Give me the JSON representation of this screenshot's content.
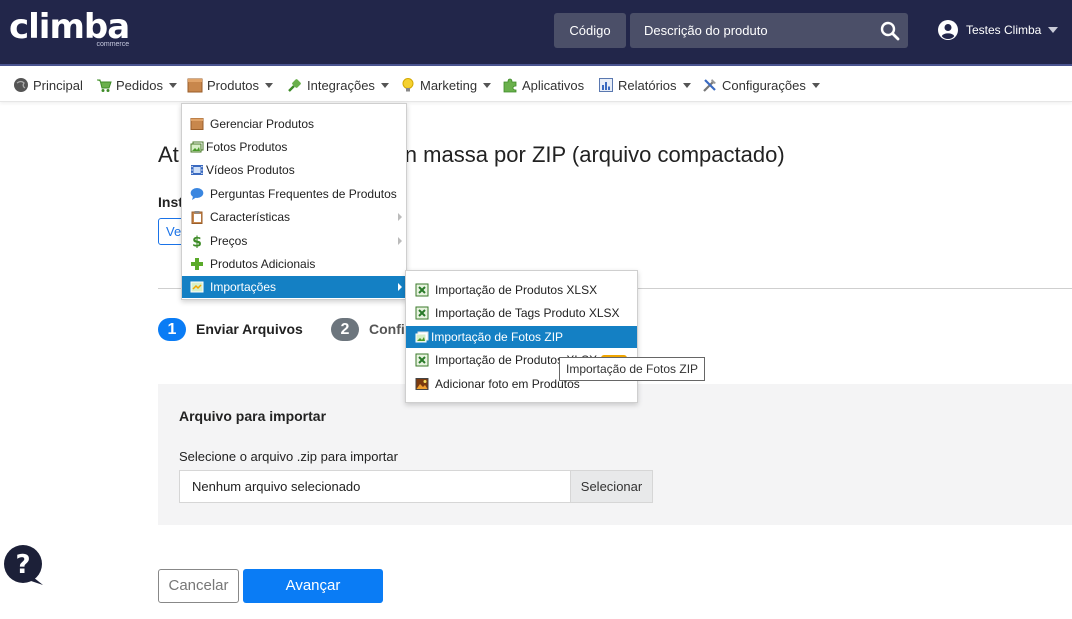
{
  "header": {
    "logo": "climba",
    "logo_sub": "commerce",
    "code_button": "Código",
    "search_placeholder": "Descrição do produto",
    "user_name": "Testes Climba"
  },
  "nav": {
    "items": [
      {
        "label": "Principal",
        "icon": "globe-icon"
      },
      {
        "label": "Pedidos",
        "icon": "cart-icon"
      },
      {
        "label": "Produtos",
        "icon": "box-icon"
      },
      {
        "label": "Integrações",
        "icon": "plug-icon"
      },
      {
        "label": "Marketing",
        "icon": "lightbulb-icon"
      },
      {
        "label": "Aplicativos",
        "icon": "puzzle-icon"
      },
      {
        "label": "Relatórios",
        "icon": "report-icon"
      },
      {
        "label": "Configurações",
        "icon": "tools-icon"
      }
    ]
  },
  "produtos_menu": [
    {
      "label": "Gerenciar Produtos"
    },
    {
      "label": "Fotos Produtos"
    },
    {
      "label": "Vídeos Produtos"
    },
    {
      "label": "Perguntas Frequentes de Produtos"
    },
    {
      "label": "Características"
    },
    {
      "label": "Preços"
    },
    {
      "label": "Produtos Adicionais"
    },
    {
      "label": "Importações"
    }
  ],
  "importacoes_menu": [
    {
      "label": "Importação de Produtos XLSX"
    },
    {
      "label": "Importação de Tags Produto XLSX"
    },
    {
      "label": "Importação de Fotos ZIP"
    },
    {
      "label": "Importação de Produtos XLSX"
    },
    {
      "label": "Adicionar foto em Produtos"
    }
  ],
  "tooltip": "Importação de Fotos ZIP",
  "page": {
    "title_left": "At",
    "title_right": "n massa por ZIP (arquivo compactado)",
    "instructions_label": "Inst",
    "view_button": "Ve",
    "steps": [
      {
        "number": "1",
        "label": "Enviar Arquivos",
        "color": "#0a7cf5"
      },
      {
        "number": "2",
        "label": "Confi",
        "color": "#6c757d"
      }
    ],
    "panel_title": "Arquivo para importar",
    "file_label": "Selecione o arquivo .zip para importar",
    "file_value": "Nenhum arquivo selecionado",
    "select_button": "Selecionar",
    "cancel_button": "Cancelar",
    "next_button": "Avançar"
  },
  "colors": {
    "header_bg": "#22264a",
    "primary": "#0a7cf5",
    "menu_active": "#1480c4"
  }
}
